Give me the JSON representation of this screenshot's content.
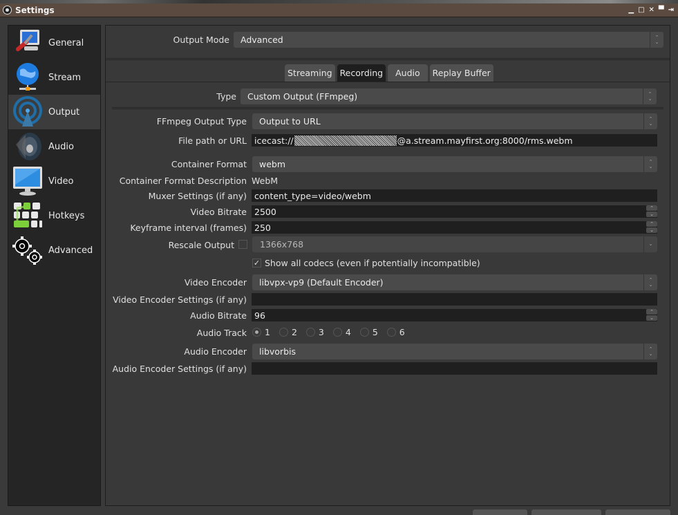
{
  "window": {
    "title": "Settings",
    "controls": [
      "minimize",
      "maximize",
      "close",
      "shade",
      "pin"
    ]
  },
  "sidebar": {
    "items": [
      {
        "label": "General",
        "icon": "computer-wrench-icon",
        "active": false
      },
      {
        "label": "Stream",
        "icon": "globe-network-icon",
        "active": false
      },
      {
        "label": "Output",
        "icon": "broadcast-antenna-icon",
        "active": true
      },
      {
        "label": "Audio",
        "icon": "speaker-icon",
        "active": false
      },
      {
        "label": "Video",
        "icon": "monitor-icon",
        "active": false
      },
      {
        "label": "Hotkeys",
        "icon": "keyboard-icon",
        "active": false
      },
      {
        "label": "Advanced",
        "icon": "gears-icon",
        "active": false
      }
    ]
  },
  "output_mode": {
    "label": "Output Mode",
    "value": "Advanced"
  },
  "tabs": [
    {
      "label": "Streaming",
      "active": false
    },
    {
      "label": "Recording",
      "active": true
    },
    {
      "label": "Audio",
      "active": false
    },
    {
      "label": "Replay Buffer",
      "active": false
    }
  ],
  "recording": {
    "type": {
      "label": "Type",
      "value": "Custom Output (FFmpeg)"
    },
    "ffmpeg_output_type": {
      "label": "FFmpeg Output Type",
      "value": "Output to URL"
    },
    "file_path": {
      "label": "File path or URL",
      "prefix": "icecast://",
      "suffix": "@a.stream.mayfirst.org:8000/rms.webm",
      "redacted": true
    },
    "container_format": {
      "label": "Container Format",
      "value": "webm"
    },
    "container_desc": {
      "label": "Container Format Description",
      "value": "WebM"
    },
    "muxer_settings": {
      "label": "Muxer Settings (if any)",
      "value": "content_type=video/webm"
    },
    "video_bitrate": {
      "label": "Video Bitrate",
      "value": "2500"
    },
    "keyframe_interval": {
      "label": "Keyframe interval (frames)",
      "value": "250"
    },
    "rescale_output": {
      "label": "Rescale Output",
      "checked": false,
      "value": "1366x768"
    },
    "show_all_codecs": {
      "label": "Show all codecs (even if potentially incompatible)",
      "checked": true
    },
    "video_encoder": {
      "label": "Video Encoder",
      "value": "libvpx-vp9 (Default Encoder)"
    },
    "video_encoder_settings": {
      "label": "Video Encoder Settings (if any)",
      "value": ""
    },
    "audio_bitrate": {
      "label": "Audio Bitrate",
      "value": "96"
    },
    "audio_track": {
      "label": "Audio Track",
      "options": [
        "1",
        "2",
        "3",
        "4",
        "5",
        "6"
      ],
      "selected": "1"
    },
    "audio_encoder": {
      "label": "Audio Encoder",
      "value": "libvorbis"
    },
    "audio_encoder_settings": {
      "label": "Audio Encoder Settings (if any)",
      "value": ""
    }
  }
}
